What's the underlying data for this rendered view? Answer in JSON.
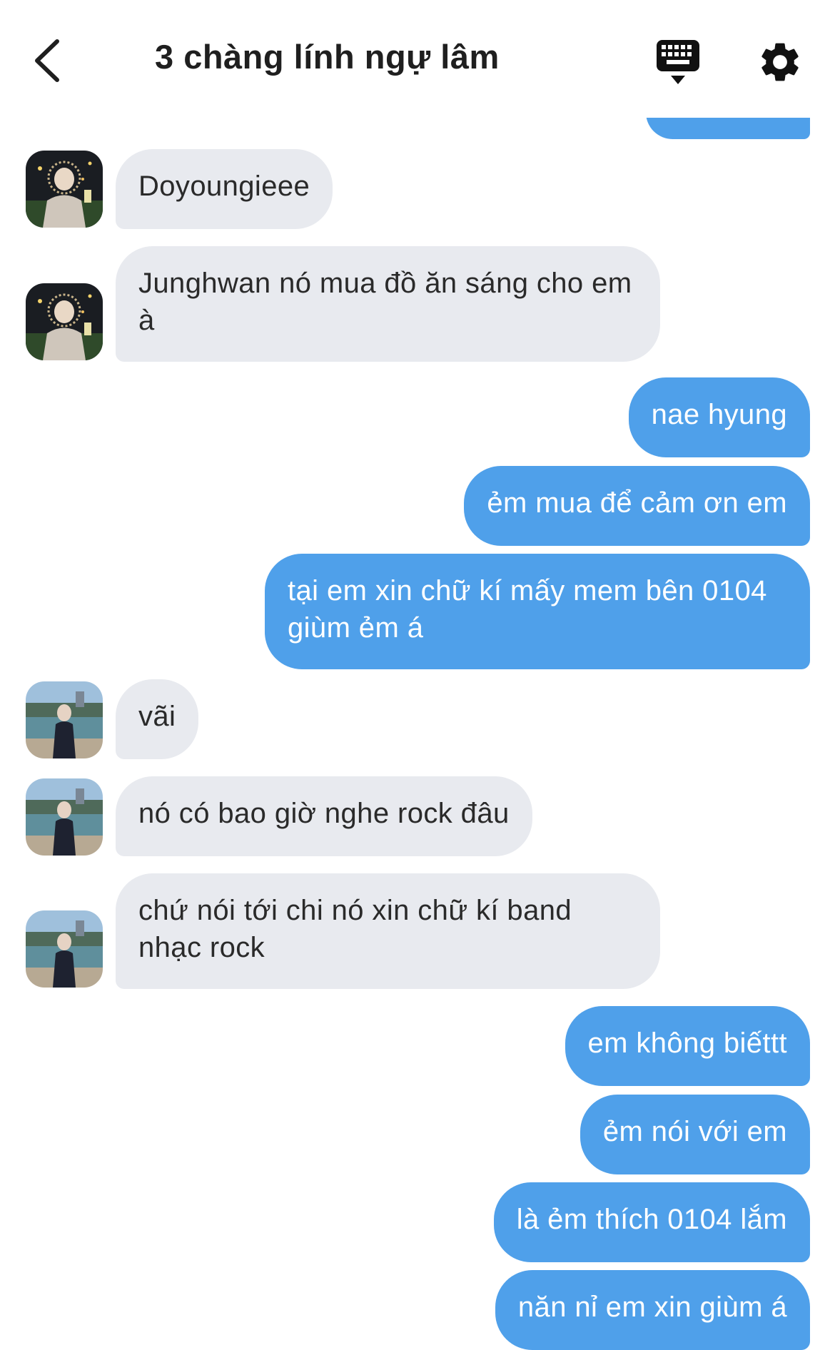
{
  "header": {
    "title": "3 chàng lính ngự lâm",
    "back_icon": "chevron-left-icon",
    "keyboard_icon": "keyboard-icon",
    "settings_icon": "gear-icon"
  },
  "colors": {
    "incoming_bubble": "#e8eaef",
    "outgoing_bubble": "#4fa0ea",
    "incoming_text": "#2a2a2a",
    "outgoing_text": "#ffffff"
  },
  "messages": [
    {
      "side": "out",
      "text": ""
    },
    {
      "side": "in",
      "sender": "avatar-1",
      "text": "Doyoungieee"
    },
    {
      "side": "in",
      "sender": "avatar-1",
      "text": "Junghwan nó mua đồ ăn sáng cho em à"
    },
    {
      "side": "out",
      "text": "nae hyung"
    },
    {
      "side": "out",
      "text": "ẻm mua để cảm ơn em"
    },
    {
      "side": "out",
      "text": "tại em xin chữ kí mấy mem bên 0104 giùm ẻm á"
    },
    {
      "side": "in",
      "sender": "avatar-2",
      "text": "vãi"
    },
    {
      "side": "in",
      "sender": "avatar-2",
      "text": "nó có bao giờ nghe rock đâu"
    },
    {
      "side": "in",
      "sender": "avatar-2",
      "text": "chứ nói tới chi nó xin chữ kí band nhạc rock"
    },
    {
      "side": "out",
      "text": "em không biếttt"
    },
    {
      "side": "out",
      "text": "ẻm nói với em"
    },
    {
      "side": "out",
      "text": "là ẻm thích 0104 lắm"
    },
    {
      "side": "out",
      "text": "năn nỉ em xin giùm á"
    }
  ]
}
